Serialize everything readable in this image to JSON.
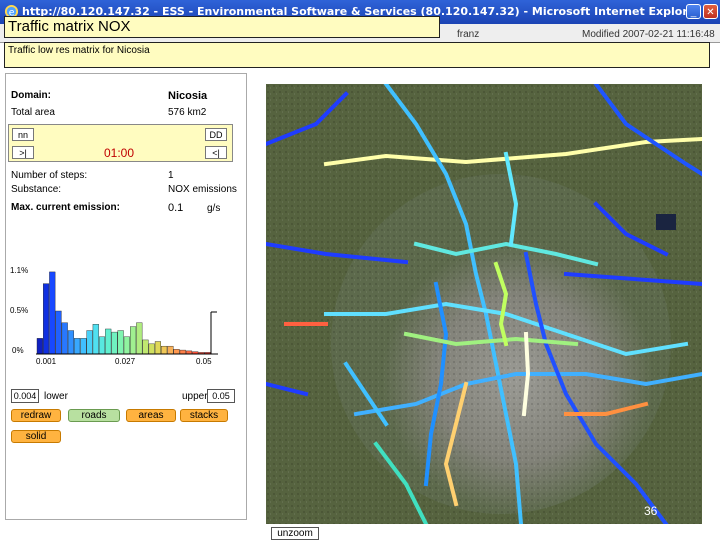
{
  "window": {
    "title": "http://80.120.147.32 - ESS - Environmental Software & Services (80.120.147.32) - Microsoft Internet Explorer",
    "minimize_icon": "minimize-icon",
    "close_icon": "close-icon"
  },
  "header": {
    "page_title": "Traffic matrix NOX",
    "user": "franz",
    "modified": "Modified 2007-02-21 11:16:48",
    "description": "Traffic low res matrix for Nicosia"
  },
  "left": {
    "domain_label": "Domain:",
    "domain_value": "Nicosia",
    "total_area_label": "Total area",
    "total_area_value": "576 km2",
    "time_buttons": [
      "nn",
      ">|",
      "DD",
      "<|"
    ],
    "time_value": "01:00",
    "steps_label": "Number of steps:",
    "steps_value": "1",
    "substance_label": "Substance:",
    "substance_value": "NOX emissions",
    "emission_label": "Max. current emission:",
    "emission_value": "0.1",
    "emission_unit": "g/s"
  },
  "histogram": {
    "y_ticks": [
      "1.1%",
      "0.5%",
      "0%"
    ],
    "x_ticks": [
      "0.001",
      "0.027",
      "0.05"
    ]
  },
  "controls": {
    "lower_value": "0.004",
    "lower_label": "lower",
    "upper_label": "upper",
    "upper_value": "0.05",
    "buttons": [
      "redraw",
      "roads",
      "areas",
      "stacks"
    ],
    "solid_button": "solid",
    "unzoom_button": "unzoom"
  },
  "slide_number": "36",
  "colors": {
    "titlebar": "#2553c9",
    "yellow_panel": "#fffcc0",
    "orange_button": "#ffb340",
    "time_red": "#c00000"
  },
  "chart_data": {
    "type": "bar",
    "categories": [],
    "series": [
      {
        "values": [
          0.2,
          0.9,
          1.05,
          0.55,
          0.4,
          0.3,
          0.2,
          0.2,
          0.3,
          0.38,
          0.22,
          0.32,
          0.28,
          0.3,
          0.22,
          0.35,
          0.4,
          0.18,
          0.13,
          0.16,
          0.1,
          0.1,
          0.06,
          0.05,
          0.04,
          0.03,
          0.02,
          0.02
        ]
      }
    ],
    "ylim": [
      0,
      1.1
    ],
    "yticks": [
      "1.1%",
      "0.5%",
      "0%"
    ],
    "xticks": [
      "0.001",
      "0.027",
      "0.05"
    ]
  }
}
